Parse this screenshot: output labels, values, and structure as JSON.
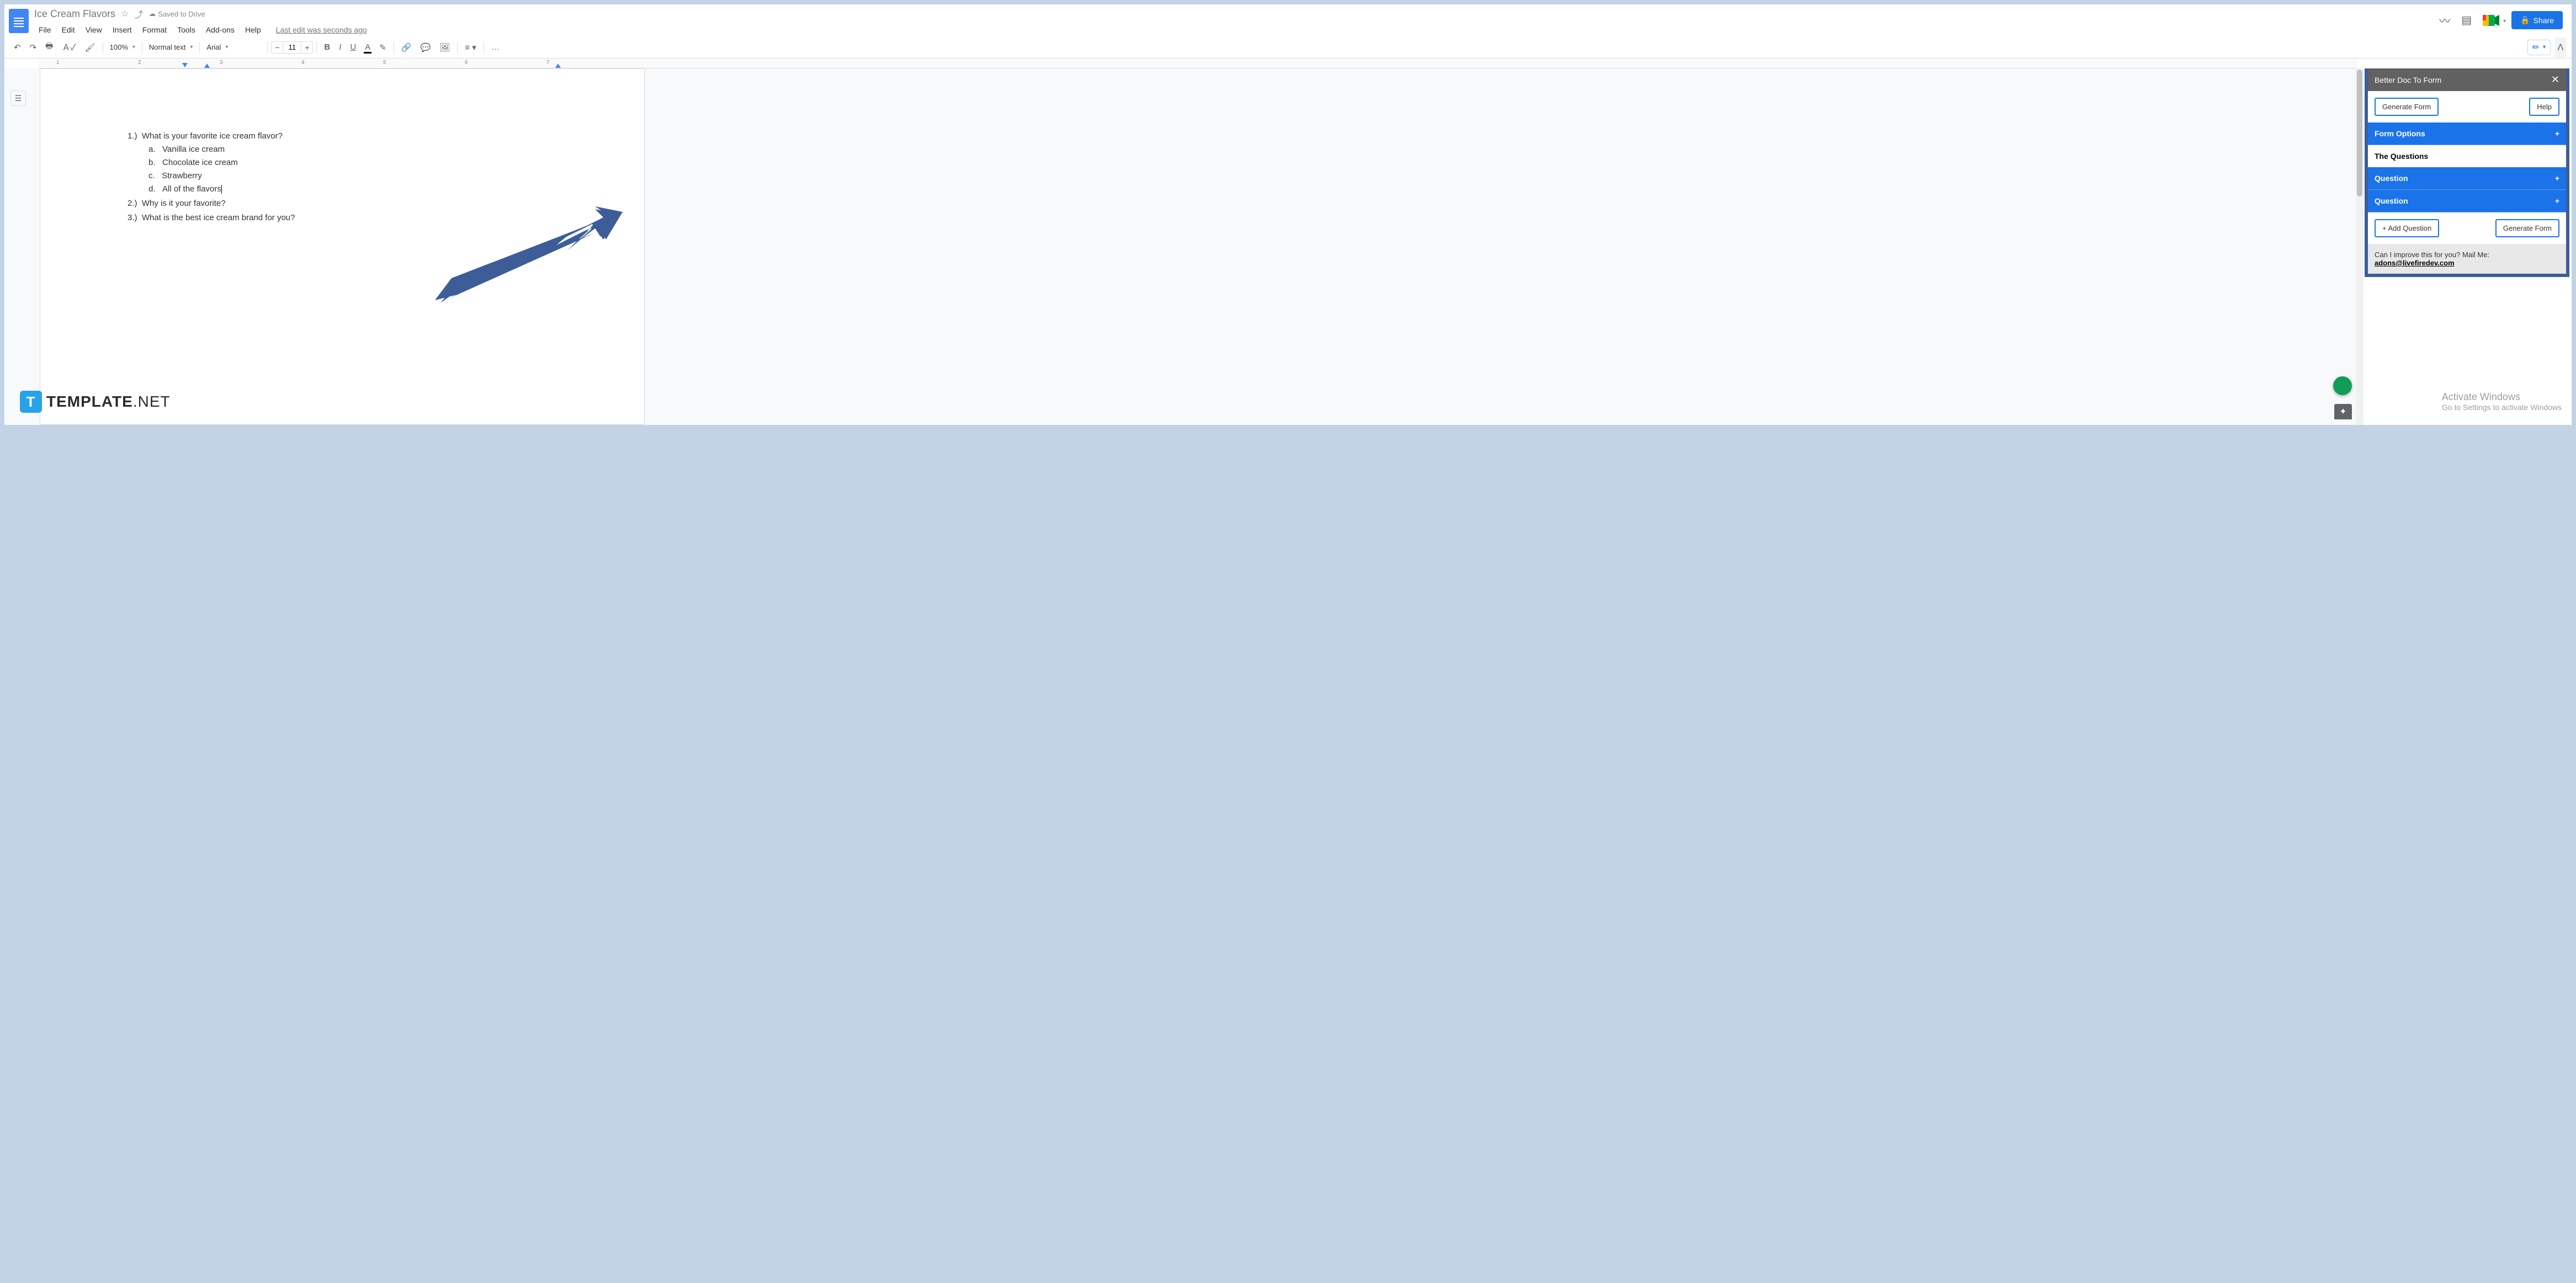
{
  "header": {
    "doc_title": "Ice Cream Flavors",
    "cloud_status": "Saved to Drive",
    "last_edit": "Last edit was seconds ago",
    "share_label": "Share"
  },
  "menubar": {
    "items": [
      "File",
      "Edit",
      "View",
      "Insert",
      "Format",
      "Tools",
      "Add-ons",
      "Help"
    ]
  },
  "toolbar": {
    "zoom": "100%",
    "style": "Normal text",
    "font": "Arial",
    "font_size": "11",
    "more": "…"
  },
  "ruler": {
    "nums": [
      "1",
      "2",
      "3",
      "4",
      "5",
      "6",
      "7"
    ]
  },
  "document": {
    "questions": [
      {
        "num": "1.)",
        "text": "What is your favorite ice cream flavor?",
        "options": [
          {
            "letter": "a.",
            "text": "Vanilla ice cream"
          },
          {
            "letter": "b.",
            "text": "Chocolate ice cream"
          },
          {
            "letter": "c.",
            "text": "Strawberry"
          },
          {
            "letter": "d.",
            "text": "All of the flavors"
          }
        ]
      },
      {
        "num": "2.)",
        "text": "Why is it your favorite?"
      },
      {
        "num": "3.)",
        "text": "What is the best ice cream brand for you?"
      }
    ]
  },
  "sidebar": {
    "title": "Better Doc To Form",
    "generate_btn": "Generate Form",
    "help_btn": "Help",
    "form_options": "Form Options",
    "the_questions": "The Questions",
    "question_label": "Question",
    "add_question": "+ Add Question",
    "generate_btn2": "Generate Form",
    "footer_text": "Can I improve this for you? Mail Me:",
    "footer_email": "adons@livefiredev.com"
  },
  "activate": {
    "line1": "Activate Windows",
    "line2": "Go to Settings to activate Windows"
  },
  "watermark": {
    "brand": "TEMPLATE",
    "suffix": ".NET"
  }
}
